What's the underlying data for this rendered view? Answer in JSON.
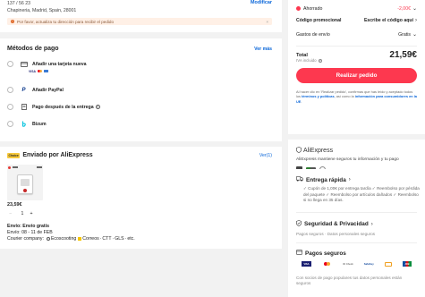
{
  "address": {
    "line1": "137 / 56 23",
    "line2": "Chapineria, Madrid, Spain, 28001",
    "modify_label": "Modificar",
    "warning_text": "Por favor, actualiza tu dirección para recibir el pedido",
    "warning_close": "×"
  },
  "payment": {
    "title": "Métodos de pago",
    "see_more": "Ver más",
    "methods": [
      {
        "label": "Añadir una tarjeta nueva"
      },
      {
        "label": "Añadir PayPal"
      },
      {
        "label": "Pago después de la entrega"
      },
      {
        "label": "Bizum"
      }
    ],
    "paypal_glyph": "P",
    "help_glyph": "?"
  },
  "shipping": {
    "badge": "Choice",
    "title": "Enviado por AliExpress",
    "view_label": "Ver(1)",
    "price": "23,59€",
    "minus": "−",
    "plus": "+",
    "quantity": "1",
    "delivery_label": "Envío: Envío gratis",
    "delivery_dates": "Envío: 08 - 11 de FEB",
    "courier_prefix": "Courier company:",
    "couriers": [
      "Ecoscooting",
      "Correos",
      "CTT",
      "GLS",
      "etc."
    ]
  },
  "summary": {
    "saved_label": "Ahorrado",
    "saved_value": "-2,00€",
    "promo_label": "Código promocional",
    "promo_value": "Escribe el código aquí",
    "shipping_label": "Gastos de envío",
    "shipping_value": "Gratis",
    "total_label": "Total",
    "total_value": "21,59€",
    "tax_note": "IVA incluido",
    "order_button": "Realizar pedido",
    "terms": {
      "before": "Al hacer clic en 'Realizar pedido', confirmas que has leído y aceptado todos los ",
      "link1": "términos y políticas",
      "middle": ", así como la ",
      "link2": "información para consumidores en la UE",
      "after": "."
    }
  },
  "trust": {
    "brand": "AliExpress",
    "tagline": "AliExpress mantiene seguros tu información y tu pago"
  },
  "features": {
    "delivery_title": "Entrega rápida",
    "delivery_points": [
      "Cupón de 1,00€ por entrega tardía",
      "Reembolso por pérdida del paquete",
      "Reembolso por artículos dañados",
      "Reembolso si no llega en 35 días."
    ],
    "security_title": "Seguridad & Privacidad",
    "security_text": "Pagos seguros · Datos personales seguros",
    "payments_title": "Pagos seguros",
    "payments_text": "Con socios de pago populares tus datos personales están seguros",
    "payment_logos": [
      "VISA",
      "MC",
      "ID Check",
      "SafeKey",
      "",
      "JCB"
    ]
  },
  "colors": {
    "accent": "#fd384f",
    "link": "#0a66d9",
    "warning_bg": "#fff0e6"
  }
}
